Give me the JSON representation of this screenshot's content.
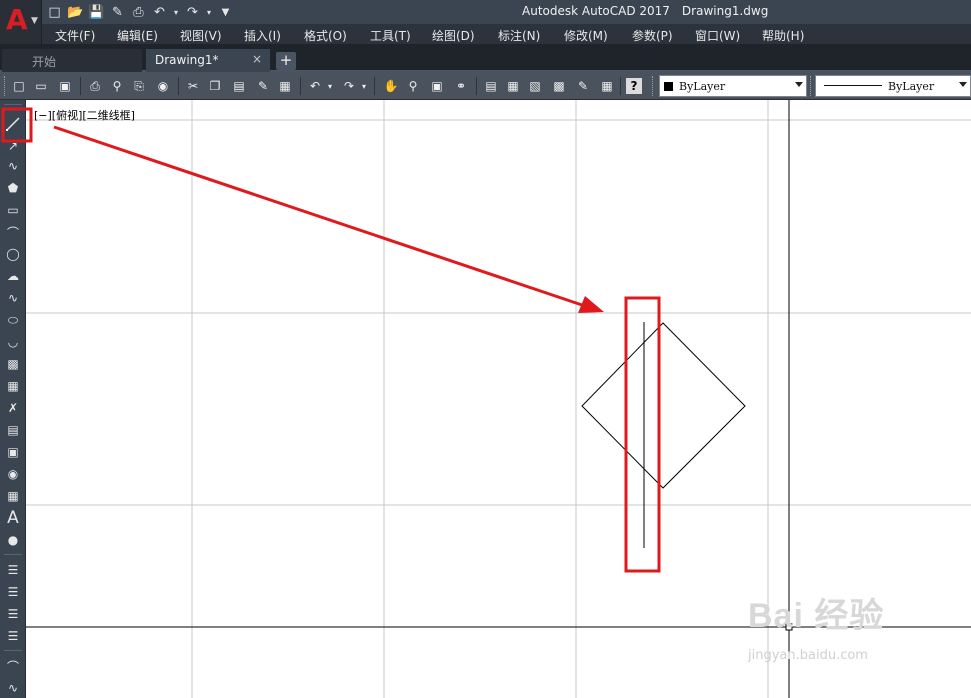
{
  "window": {
    "app_title": "Autodesk AutoCAD 2017",
    "document_title": "Drawing1.dwg",
    "app_button_letter": "A",
    "quick_access_icons": [
      "new-icon",
      "open-icon",
      "save-icon",
      "save-as-icon",
      "print-icon",
      "undo-icon",
      "redo-icon",
      "customize-icon"
    ]
  },
  "menu": {
    "items": [
      "文件(F)",
      "编辑(E)",
      "视图(V)",
      "插入(I)",
      "格式(O)",
      "工具(T)",
      "绘图(D)",
      "标注(N)",
      "修改(M)",
      "参数(P)",
      "窗口(W)",
      "帮助(H)"
    ]
  },
  "tabs": {
    "items": [
      {
        "label": "开始",
        "active": false
      },
      {
        "label": "Drawing1*",
        "active": true
      }
    ],
    "close_glyph": "×",
    "add_glyph": "+"
  },
  "toolbar": {
    "layer_combo": "ByLayer",
    "linetype_combo": "ByLayer",
    "icons": [
      "new-icon",
      "open-icon",
      "save-icon",
      "plot-icon",
      "plot-preview-icon",
      "publish-icon",
      "3d-print-icon",
      "cut-icon",
      "copy-icon",
      "paste-icon",
      "match-properties-icon",
      "block-editor-icon",
      "undo-icon",
      "redo-icon",
      "pan-icon",
      "zoom-realtime-icon",
      "zoom-window-icon",
      "zoom-previous-icon",
      "properties-icon",
      "design-center-icon",
      "tool-palettes-icon",
      "sheet-set-icon",
      "markup-icon",
      "calculator-icon",
      "help-icon"
    ]
  },
  "left_toolbar": {
    "icons": [
      "line-icon",
      "construction-line-icon",
      "polyline-icon",
      "polygon-icon",
      "rectangle-icon",
      "arc-icon",
      "circle-icon",
      "revision-cloud-icon",
      "spline-icon",
      "ellipse-icon",
      "ellipse-arc-icon",
      "insert-block-icon",
      "make-block-icon",
      "point-icon",
      "hatch-icon",
      "gradient-icon",
      "region-icon",
      "table-icon",
      "multiline-text-icon",
      "add-selected-icon",
      "layer-states-icon",
      "layer-icon",
      "layer-previous-icon",
      "layer-walk-icon",
      "polyline-edit-icon",
      "spline-edit-icon"
    ],
    "text_icon_glyph": "A",
    "highlighted": "line-icon"
  },
  "viewport": {
    "label": "[−][俯视][二维线框]"
  },
  "annotation": {
    "arrow_color": "#e0191c",
    "highlight_color": "#e0191c"
  },
  "watermark": {
    "brand": "Bai 经验",
    "url": "jingyan.baidu.com"
  },
  "colors": {
    "title_bar": "#3b4451",
    "menu_bar": "#2d333c",
    "toolbar": "#4a525e",
    "grid": "#c8c8c8",
    "axis": "#000000"
  }
}
